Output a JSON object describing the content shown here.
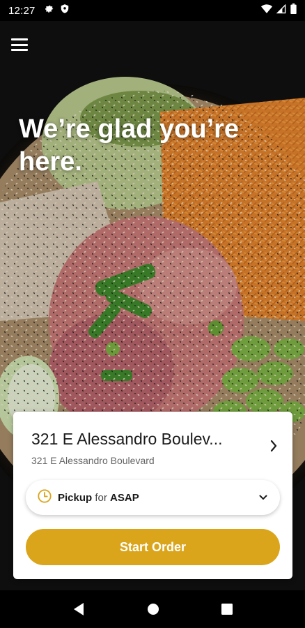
{
  "status_bar": {
    "time": "12:27",
    "icons_left": [
      "gear-icon",
      "shield-icon"
    ],
    "icons_right": [
      "wifi-icon",
      "signal-icon",
      "battery-icon"
    ]
  },
  "hero": {
    "headline": "We’re glad you’re here.",
    "image": "poke-bowl-photo"
  },
  "location": {
    "name": "321 E Alessandro Boulev...",
    "address": "321 E Alessandro Boulevard"
  },
  "pickup": {
    "mode": "Pickup",
    "connector": "for",
    "time": "ASAP"
  },
  "actions": {
    "start_order": "Start Order"
  },
  "colors": {
    "accent": "#dba51b",
    "card": "#ffffff",
    "text": "#1b1b1b"
  },
  "nav": {
    "icons": [
      "back-icon",
      "home-icon",
      "recents-icon"
    ]
  }
}
